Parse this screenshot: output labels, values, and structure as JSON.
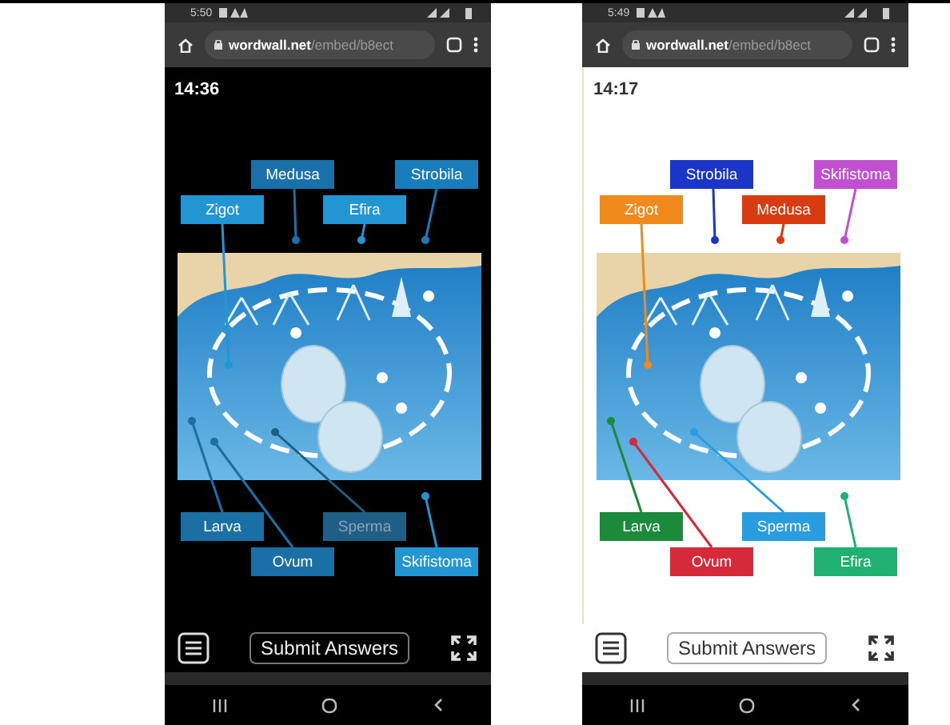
{
  "phones": [
    {
      "kind": "dark",
      "status_bar": {
        "time": "5:50"
      },
      "address_bar": {
        "domain": "wordwall.net",
        "path": "/embed/b8ect"
      },
      "timer": "14:36",
      "labels": [
        {
          "text": "Zigot",
          "color": "#2196d3",
          "dimmed": false
        },
        {
          "text": "Medusa",
          "color": "#1a70a8",
          "dimmed": false
        },
        {
          "text": "Efira",
          "color": "#2196d3",
          "dimmed": false
        },
        {
          "text": "Strobila",
          "color": "#1a7dbb",
          "dimmed": false
        },
        {
          "text": "Larva",
          "color": "#1a6fa5",
          "dimmed": false
        },
        {
          "text": "Ovum",
          "color": "#1a6fa5",
          "dimmed": false
        },
        {
          "text": "Sperma",
          "color": "#1f5f85",
          "dimmed": true
        },
        {
          "text": "Skifistoma",
          "color": "#2196d3",
          "dimmed": false
        }
      ],
      "submit_button": "Submit Answers"
    },
    {
      "kind": "light",
      "status_bar": {
        "time": "5:49"
      },
      "address_bar": {
        "domain": "wordwall.net",
        "path": "/embed/b8ect"
      },
      "timer": "14:17",
      "labels": [
        {
          "text": "Zigot",
          "color": "#f08a1c",
          "dimmed": false
        },
        {
          "text": "Strobila",
          "color": "#1b35c8",
          "dimmed": false
        },
        {
          "text": "Medusa",
          "color": "#d83a12",
          "dimmed": false
        },
        {
          "text": "Skifistoma",
          "color": "#c050d0",
          "dimmed": false
        },
        {
          "text": "Larva",
          "color": "#1b8a3a",
          "dimmed": false
        },
        {
          "text": "Ovum",
          "color": "#d42a3a",
          "dimmed": false
        },
        {
          "text": "Sperma",
          "color": "#2a9ce0",
          "dimmed": false
        },
        {
          "text": "Efira",
          "color": "#20b070",
          "dimmed": false
        }
      ],
      "submit_button": "Submit Answers"
    }
  ]
}
